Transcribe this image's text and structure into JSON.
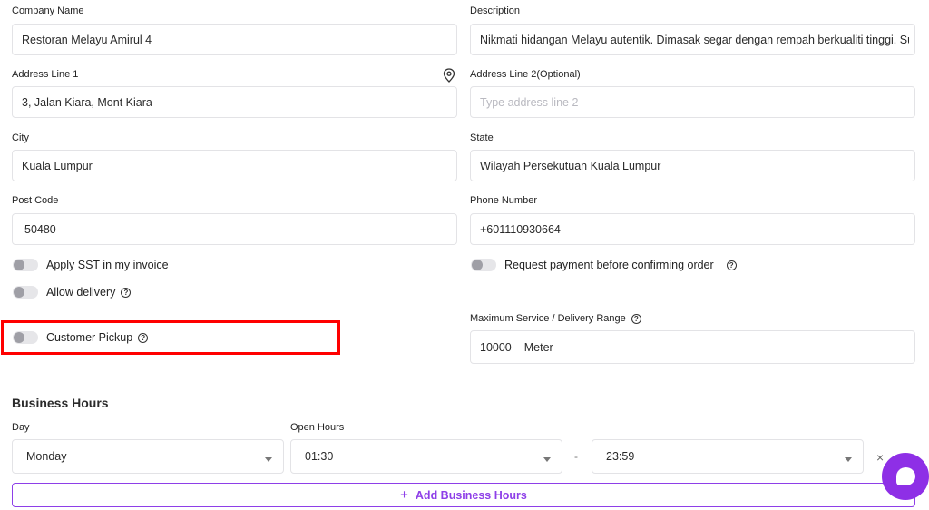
{
  "form": {
    "company_name_label": "Company Name",
    "company_name_value": "Restoran Melayu Amirul 4",
    "description_label": "Description",
    "description_value": "Nikmati hidangan Melayu autentik. Dimasak segar dengan rempah berkualiti tinggi. Suasa",
    "address1_label": "Address Line 1",
    "address1_value": "3, Jalan Kiara, Mont Kiara",
    "address2_label": "Address Line 2(Optional)",
    "address2_placeholder": "Type address line 2",
    "city_label": "City",
    "city_value": "Kuala Lumpur",
    "state_label": "State",
    "state_value": "Wilayah Persekutuan Kuala Lumpur",
    "postcode_label": "Post Code",
    "postcode_value": "50480",
    "phone_label": "Phone Number",
    "phone_value": "+601110930664"
  },
  "toggles": {
    "sst_label": "Apply SST in my invoice",
    "request_payment_label": "Request payment before confirming order",
    "delivery_label": "Allow delivery",
    "pickup_label": "Customer Pickup"
  },
  "range": {
    "label": "Maximum Service / Delivery Range",
    "value": "10000",
    "unit": "Meter"
  },
  "business_hours": {
    "title": "Business Hours",
    "day_label": "Day",
    "open_hours_label": "Open Hours",
    "day_value": "Monday",
    "open_value": "01:30",
    "separator": "-",
    "close_value": "23:59",
    "remove_glyph": "×",
    "add_plus": "+",
    "add_label": "Add Business Hours"
  },
  "icons": {
    "location": "location-pin-icon",
    "help": "help-circle-icon",
    "caret": "chevron-down-icon",
    "remove": "close-icon",
    "chat": "chat-bubble-icon"
  },
  "colors": {
    "accent": "#8e3fe8",
    "highlight": "#ff0000",
    "border": "#e3e3e6"
  }
}
